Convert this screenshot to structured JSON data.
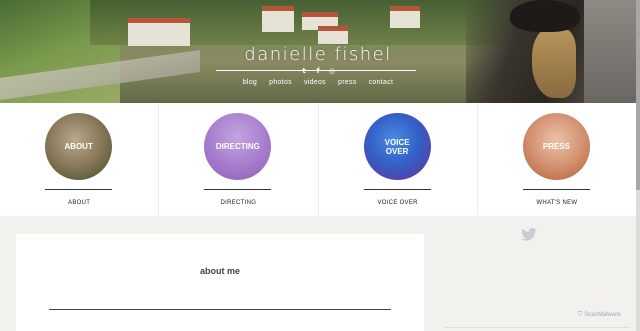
{
  "header": {
    "site_title": "danielle fishel",
    "social": [
      {
        "name": "twitter-icon",
        "glyph": "t"
      },
      {
        "name": "facebook-icon",
        "glyph": "f"
      },
      {
        "name": "instagram-icon",
        "glyph": "◎"
      }
    ],
    "nav": [
      "blog",
      "photos",
      "videos",
      "press",
      "contact"
    ]
  },
  "features": [
    {
      "circle_label": "ABOUT",
      "caption": "ABOUT"
    },
    {
      "circle_label": "DIRECTING",
      "caption": "DIRECTING"
    },
    {
      "circle_label": "VOICE OVER",
      "caption": "VOICE OVER"
    },
    {
      "circle_label": "PRESS",
      "caption": "WHAT'S NEW"
    }
  ],
  "content": {
    "about_heading": "about me"
  },
  "badge": {
    "text": "ScanMalware"
  },
  "colors": {
    "twitter": "#c9ccd1",
    "background": "#f3f1ee"
  }
}
